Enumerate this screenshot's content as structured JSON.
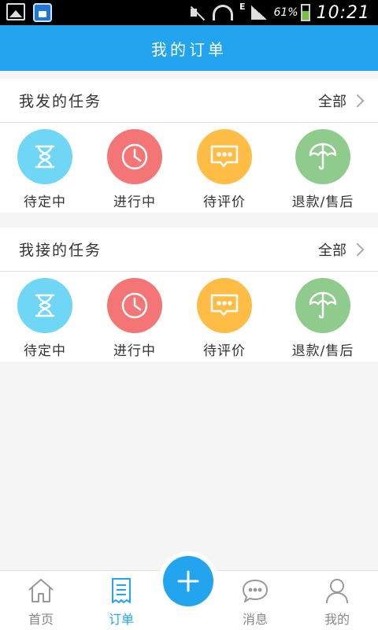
{
  "status_bar": {
    "battery_percent": "61%",
    "network_type": "E",
    "time": "10:21",
    "icons": [
      "image-icon",
      "app-icon",
      "mute-icon",
      "wifi-icon",
      "signal-icon",
      "battery-icon"
    ]
  },
  "header": {
    "title": "我的订单"
  },
  "sections": [
    {
      "title": "我发的任务",
      "all_label": "全部",
      "items": [
        {
          "label": "待定中",
          "icon": "hourglass-icon",
          "color": "#6fd6f5"
        },
        {
          "label": "进行中",
          "icon": "clock-icon",
          "color": "#f47575"
        },
        {
          "label": "待评价",
          "icon": "chat-icon",
          "color": "#ffbd45"
        },
        {
          "label": "退款/售后",
          "icon": "umbrella-icon",
          "color": "#8ecb8c"
        }
      ]
    },
    {
      "title": "我接的任务",
      "all_label": "全部",
      "items": [
        {
          "label": "待定中",
          "icon": "hourglass-icon",
          "color": "#6fd6f5"
        },
        {
          "label": "进行中",
          "icon": "clock-icon",
          "color": "#f47575"
        },
        {
          "label": "待评价",
          "icon": "chat-icon",
          "color": "#ffbd45"
        },
        {
          "label": "退款/售后",
          "icon": "umbrella-icon",
          "color": "#8ecb8c"
        }
      ]
    }
  ],
  "bottom_nav": {
    "items": [
      {
        "label": "首页",
        "icon": "home-icon"
      },
      {
        "label": "订单",
        "icon": "order-icon",
        "active": true
      },
      {
        "label": "",
        "icon": "plus-icon"
      },
      {
        "label": "消息",
        "icon": "message-icon"
      },
      {
        "label": "我的",
        "icon": "user-icon"
      }
    ]
  },
  "colors": {
    "accent": "#22a5ee",
    "background": "#f5f5f5",
    "text": "#333333",
    "muted": "#888888"
  }
}
